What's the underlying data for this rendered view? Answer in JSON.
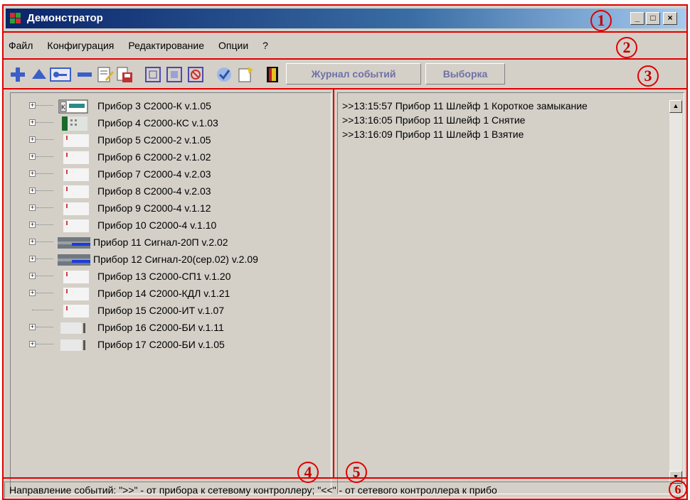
{
  "window": {
    "title": "Демонстратор",
    "controls": {
      "minimize": "_",
      "maximize": "□",
      "close": "×"
    }
  },
  "menu": [
    "Файл",
    "Конфигурация",
    "Редактирование",
    "Опции",
    "?"
  ],
  "toolbar": {
    "icons": [
      "add-icon",
      "eject-icon",
      "key-icon",
      "remove-icon",
      "edit-doc-icon",
      "save-doc-icon",
      "frame-icon",
      "frame-alt-icon",
      "cancel-icon",
      "check-icon",
      "new-doc-icon",
      "exit-door-icon"
    ],
    "tabs": {
      "journal": "Журнал событий",
      "selection": "Выборка"
    }
  },
  "tree": {
    "items": [
      {
        "label": "Прибор 3 С2000-К v.1.05",
        "icon": "keypad-device-icon",
        "expandable": true
      },
      {
        "label": "Прибор 4 С2000-КС v.1.03",
        "icon": "keypad-green-device-icon",
        "expandable": true
      },
      {
        "label": "Прибор 5 С2000-2 v.1.05",
        "icon": "device-icon",
        "expandable": true
      },
      {
        "label": "Прибор 6 С2000-2 v.1.02",
        "icon": "device-icon",
        "expandable": true
      },
      {
        "label": "Прибор 7 С2000-4 v.2.03",
        "icon": "device-icon",
        "expandable": true
      },
      {
        "label": "Прибор 8 С2000-4 v.2.03",
        "icon": "device-icon",
        "expandable": true
      },
      {
        "label": "Прибор 9 С2000-4 v.1.12",
        "icon": "device-icon",
        "expandable": true
      },
      {
        "label": "Прибор 10 С2000-4 v.1.10",
        "icon": "device-icon",
        "expandable": true
      },
      {
        "label": "Прибор 11 Сигнал-20П v.2.02",
        "icon": "panel-device-icon",
        "expandable": true
      },
      {
        "label": "Прибор 12 Сигнал-20(сер.02) v.2.09",
        "icon": "panel-device-icon",
        "expandable": true
      },
      {
        "label": "Прибор 13 С2000-СП1 v.1.20",
        "icon": "device-icon",
        "expandable": true
      },
      {
        "label": "Прибор 14 С2000-КДЛ v.1.21",
        "icon": "device-icon",
        "expandable": true
      },
      {
        "label": "Прибор 15 С2000-ИТ v.1.07",
        "icon": "device-icon",
        "expandable": false
      },
      {
        "label": "Прибор 16 С2000-БИ v.1.11",
        "icon": "bar-device-icon",
        "expandable": true
      },
      {
        "label": "Прибор 17 С2000-БИ v.1.05",
        "icon": "bar-device-icon",
        "expandable": true
      }
    ]
  },
  "log": {
    "lines": [
      ">>13:15:57 Прибор 11 Шлейф 1 Короткое замыкание",
      ">>13:16:05 Прибор 11 Шлейф 1 Снятие",
      ">>13:16:09 Прибор 11 Шлейф 1 Взятие"
    ]
  },
  "status": "Направление событий: \">>\" - от прибора к сетевому контроллеру; \"<<\" - от сетевого контроллера к прибо",
  "annotations": [
    "1",
    "2",
    "3",
    "4",
    "5",
    "6"
  ],
  "colors": {
    "annotation": "#e00000",
    "titlebar": "#0a246a",
    "face": "#d4d0c8",
    "tab_text": "#7070a8"
  }
}
